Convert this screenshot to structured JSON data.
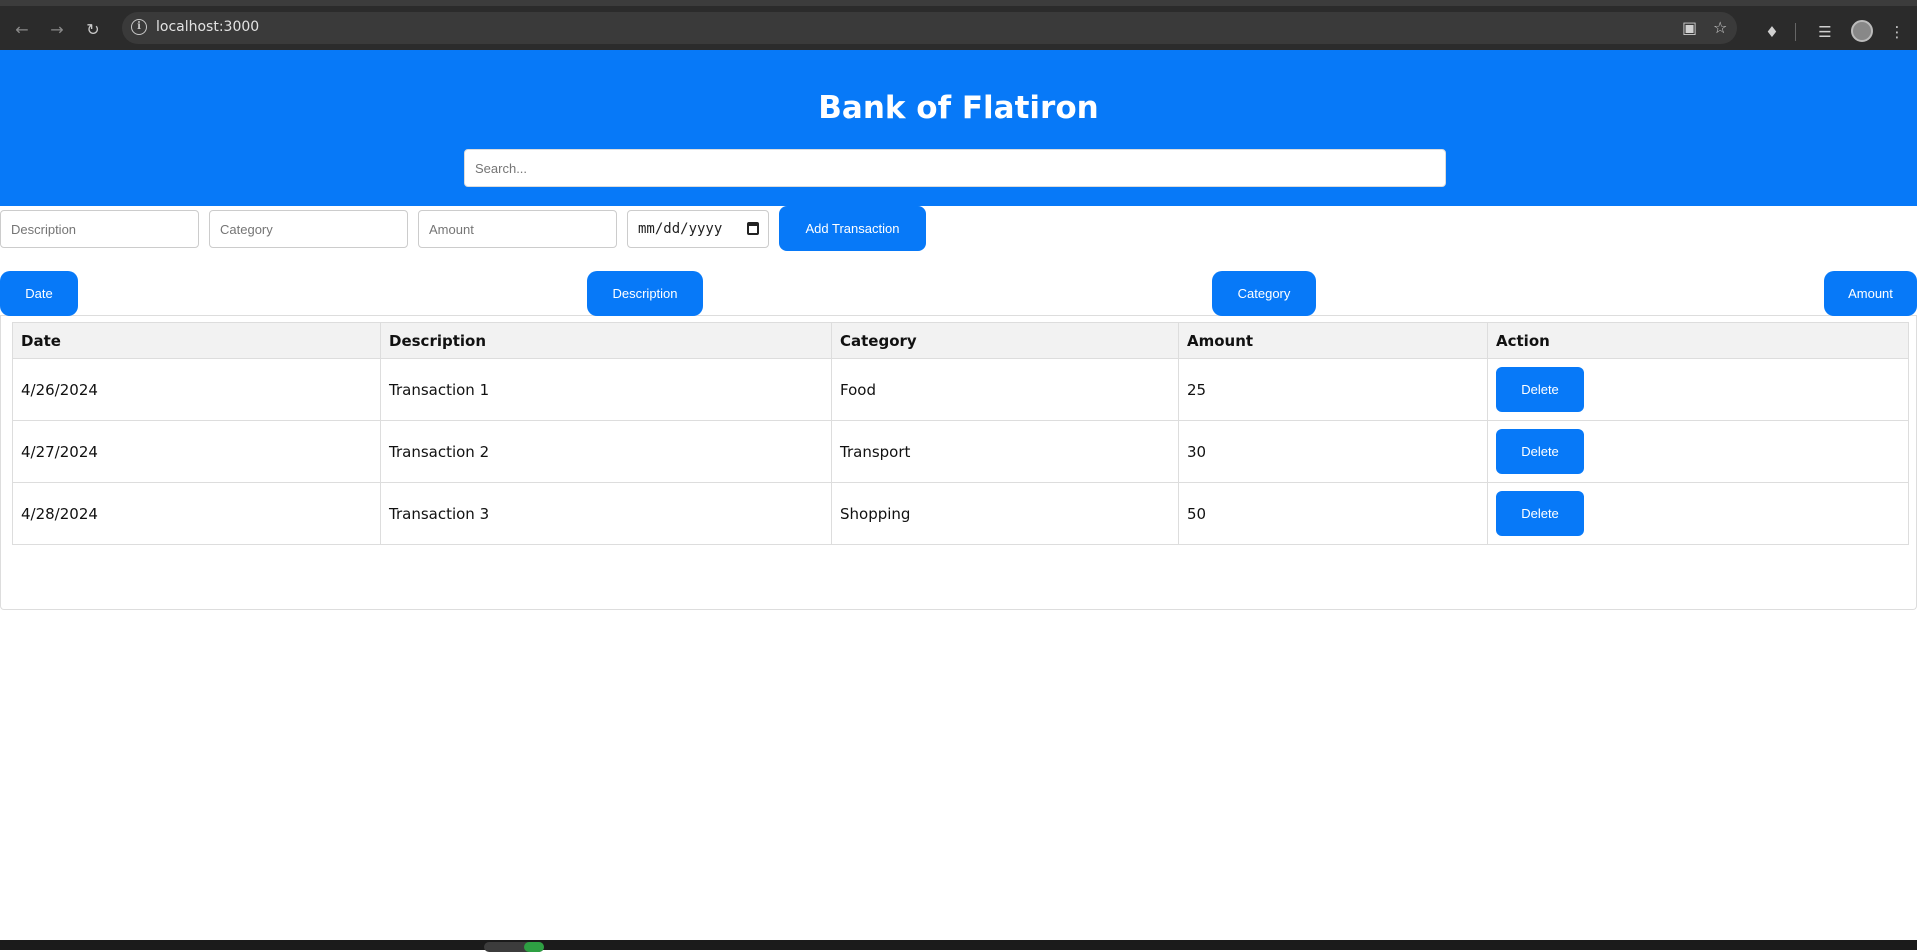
{
  "browser": {
    "url": "localhost:3000"
  },
  "header": {
    "title": "Bank of Flatiron",
    "search_placeholder": "Search..."
  },
  "form": {
    "description_placeholder": "Description",
    "category_placeholder": "Category",
    "amount_placeholder": "Amount",
    "date_placeholder": "mm/dd/yyyy",
    "submit_label": "Add Transaction"
  },
  "sort_buttons": {
    "date": "Date",
    "description": "Description",
    "category": "Category",
    "amount": "Amount"
  },
  "table": {
    "headers": [
      "Date",
      "Description",
      "Category",
      "Amount",
      "Action"
    ],
    "rows": [
      {
        "date": "4/26/2024",
        "description": "Transaction 1",
        "category": "Food",
        "amount": "25",
        "action": "Delete"
      },
      {
        "date": "4/27/2024",
        "description": "Transaction 2",
        "category": "Transport",
        "amount": "30",
        "action": "Delete"
      },
      {
        "date": "4/28/2024",
        "description": "Transaction 3",
        "category": "Shopping",
        "amount": "50",
        "action": "Delete"
      }
    ]
  },
  "colors": {
    "brand": "#0779f8",
    "header_text": "#ffffff",
    "table_header_bg": "#f2f2f2"
  }
}
